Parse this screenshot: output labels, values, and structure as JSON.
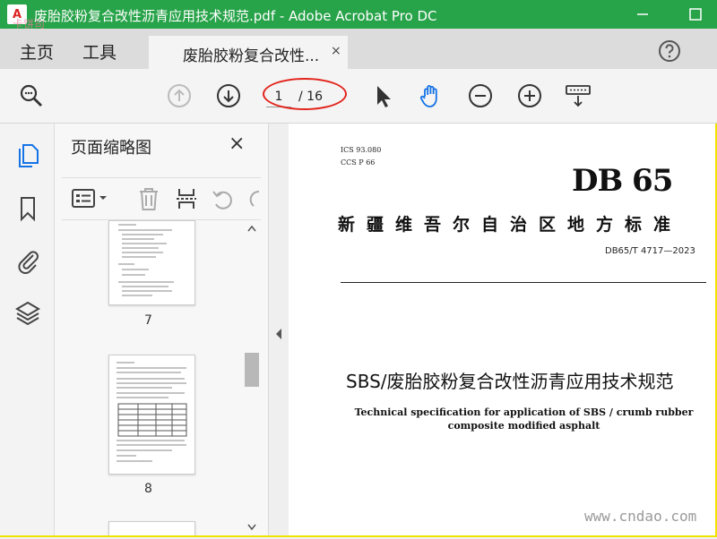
{
  "window": {
    "title": "废胎胶粉复合改性沥青应用技术规范.pdf - Adobe Acrobat Pro DC",
    "logo_text": "A",
    "watermark_top": "卡饼司"
  },
  "menu": {
    "home": "主页",
    "tools": "工具"
  },
  "tab": {
    "label": "废胎胶粉复合改性...",
    "close": "×"
  },
  "toolbar": {
    "current_page": "1",
    "total_pages": "/ 16"
  },
  "panel": {
    "title": "页面缩略图",
    "close": "×",
    "thumbnails": [
      {
        "label": "7"
      },
      {
        "label": "8"
      }
    ]
  },
  "document": {
    "ics": "ICS  93.080",
    "ccs": "CCS  P  66",
    "logo": "DB 65",
    "standard": "新疆维吾尔自治区地方标准",
    "code": "DB65/T 4717—2023",
    "title": "SBS/废胎胶粉复合改性沥青应用技术规范",
    "english_line1": "Technical specification for application of SBS / crumb rubber",
    "english_line2": "composite modified asphalt"
  },
  "watermark": "www.cndao.com",
  "colors": {
    "titlebar": "#27a349",
    "accent": "#1473e6",
    "highlight": "#e2231a"
  }
}
